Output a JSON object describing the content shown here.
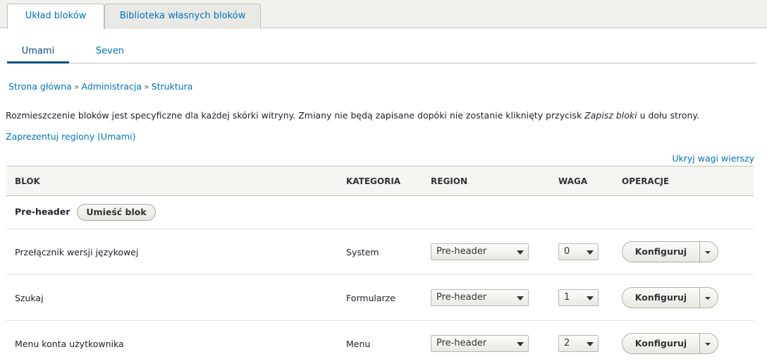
{
  "primary_tabs": [
    "Układ bloków",
    "Biblioteka własnych bloków"
  ],
  "secondary_tabs": [
    "Umami",
    "Seven"
  ],
  "breadcrumb": [
    "Strona główna",
    "Administracja",
    "Struktura"
  ],
  "breadcrumb_sep": "»",
  "description": {
    "before": "Rozmieszczenie bloków jest specyficzne dla każdej skórki witryny. Zmiany nie będą zapisane dopóki nie zostanie kliknięty przycisk ",
    "em": "Zapisz bloki",
    "after": " u dołu strony."
  },
  "demo_link": "Zaprezentuj regiony (Umami)",
  "weights_link": "Ukryj wagi wierszy",
  "table": {
    "headers": [
      "Blok",
      "Kategoria",
      "Region",
      "Waga",
      "Operacje"
    ],
    "region_title": "Pre-header",
    "place_block": "Umieść blok",
    "rows": [
      {
        "block": "Przełącznik wersji językowej",
        "category": "System",
        "region": "Pre-header",
        "weight": "0",
        "operation": "Konfiguruj"
      },
      {
        "block": "Szukaj",
        "category": "Formularze",
        "region": "Pre-header",
        "weight": "1",
        "operation": "Konfiguruj"
      },
      {
        "block": "Menu konta użytkownika",
        "category": "Menu",
        "region": "Pre-header",
        "weight": "2",
        "operation": "Konfiguruj"
      }
    ]
  },
  "colors": {
    "link": "#0074bd",
    "active_tab_underline": "#004f80"
  }
}
